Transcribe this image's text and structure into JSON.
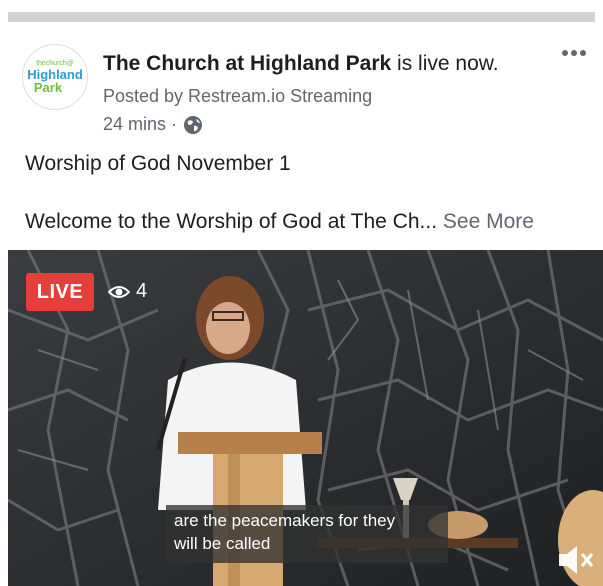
{
  "post": {
    "page_name": "The Church at Highland Park",
    "status_text": " is live now.",
    "posted_by": "Posted by Restream.io Streaming",
    "time_ago": "24 mins ·",
    "privacy_icon": "globe-icon",
    "title": "Worship of God November 1",
    "description": "Welcome to the Worship of God at The Ch...",
    "see_more": "See More",
    "more_icon": "more-options-icon"
  },
  "avatar": {
    "small_text": "thechurch@",
    "line1": "Highland",
    "line2": "Park",
    "colors": {
      "blue": "#2f9bd4",
      "green": "#6bbf3b"
    }
  },
  "video": {
    "live_label": "LIVE",
    "viewer_count": "4",
    "viewer_icon": "eye-icon",
    "caption_lines": [
      "are the peacemakers for they",
      "will be called"
    ],
    "mute_icon": "speaker-muted-icon",
    "live_color": "#e63f3b"
  }
}
